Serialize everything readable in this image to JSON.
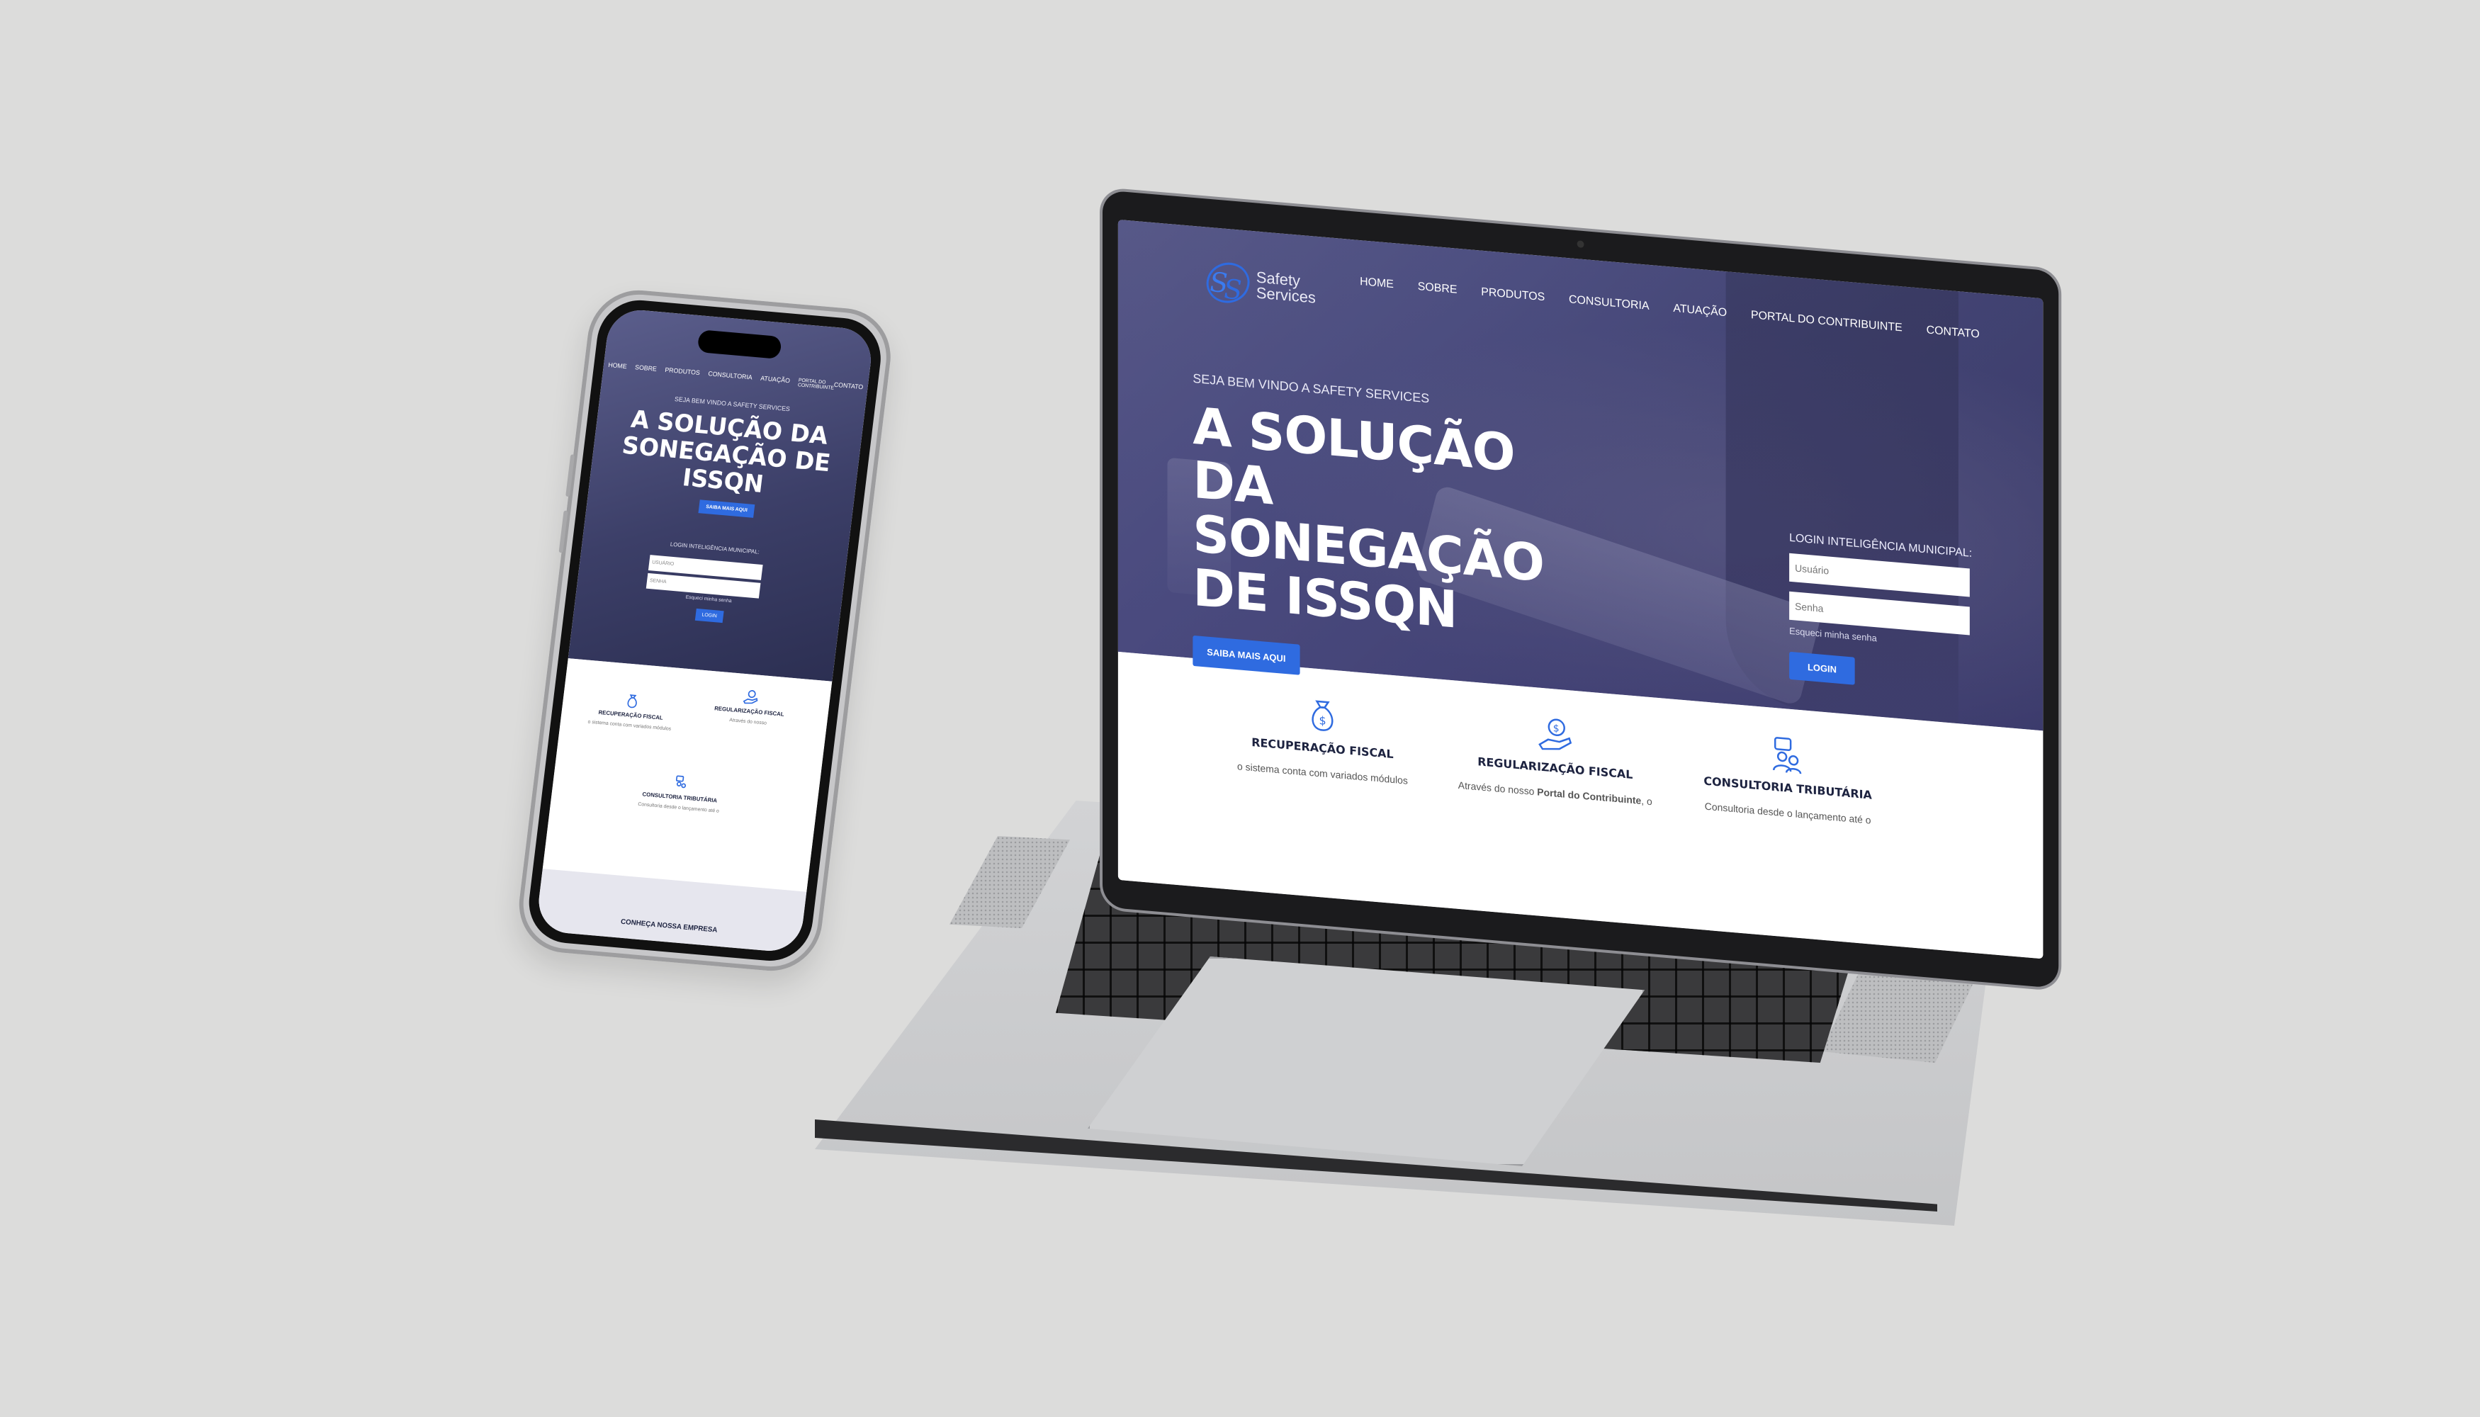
{
  "brand": {
    "name_line1": "Safety",
    "name_line2": "Services",
    "monogram": "SS"
  },
  "nav": {
    "items": [
      "HOME",
      "SOBRE",
      "PRODUTOS",
      "CONSULTORIA",
      "ATUAÇÃO",
      "PORTAL DO CONTRIBUINTE",
      "CONTATO"
    ]
  },
  "hero": {
    "welcome": "SEJA BEM VINDO A SAFETY SERVICES",
    "headline": "A SOLUÇÃO DA SONEGAÇÃO DE ISSQN",
    "cta": "SAIBA MAIS AQUI"
  },
  "login": {
    "title": "LOGIN INTELIGÊNCIA MUNICIPAL:",
    "user_placeholder": "Usuário",
    "password_placeholder": "Senha",
    "forgot": "Esqueci minha senha",
    "button": "LOGIN"
  },
  "services": [
    {
      "title": "RECUPERAÇÃO FISCAL",
      "text": "o sistema conta com variados módulos",
      "icon": "money-bag-icon"
    },
    {
      "title": "REGULARIZAÇÃO FISCAL",
      "text_prefix": "Através do nosso ",
      "text_bold": "Portal do Contribuinte",
      "text_suffix": ", o",
      "icon": "hand-coin-icon"
    },
    {
      "title": "CONSULTORIA TRIBUTÁRIA",
      "text": "Consultoria desde o lançamento até o",
      "icon": "consulting-people-icon"
    }
  ],
  "mobile": {
    "nav": [
      "HOME",
      "SOBRE",
      "PRODUTOS",
      "CONSULTORIA",
      "ATUAÇÃO",
      "PORTAL DO CONTRIBUINTE",
      "CONTATO"
    ],
    "user_placeholder": "USUÁRIO",
    "password_placeholder": "SENHA",
    "footer_title": "CONHEÇA NOSSA EMPRESA"
  },
  "colors": {
    "accent": "#2f6be0",
    "hero_overlay": "#4a4f7a",
    "dark_text": "#1d2340",
    "background": "#dcdcdb"
  }
}
